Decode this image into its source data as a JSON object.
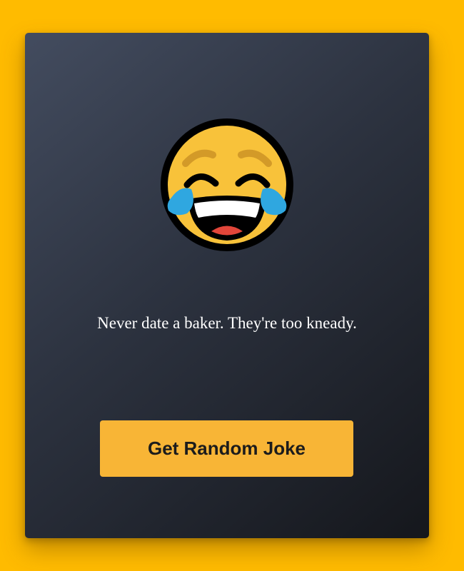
{
  "joke": {
    "text": "Never date a baker. They're too kneady."
  },
  "button": {
    "label": "Get Random Joke"
  },
  "icon": {
    "name": "face-with-tears-of-joy-icon"
  },
  "colors": {
    "background": "#FFBB00",
    "card_top": "#434c5f",
    "card_bottom": "#15171c",
    "button": "#F8B536",
    "button_text": "#1c1c1c",
    "joke_text": "#ffffff"
  }
}
